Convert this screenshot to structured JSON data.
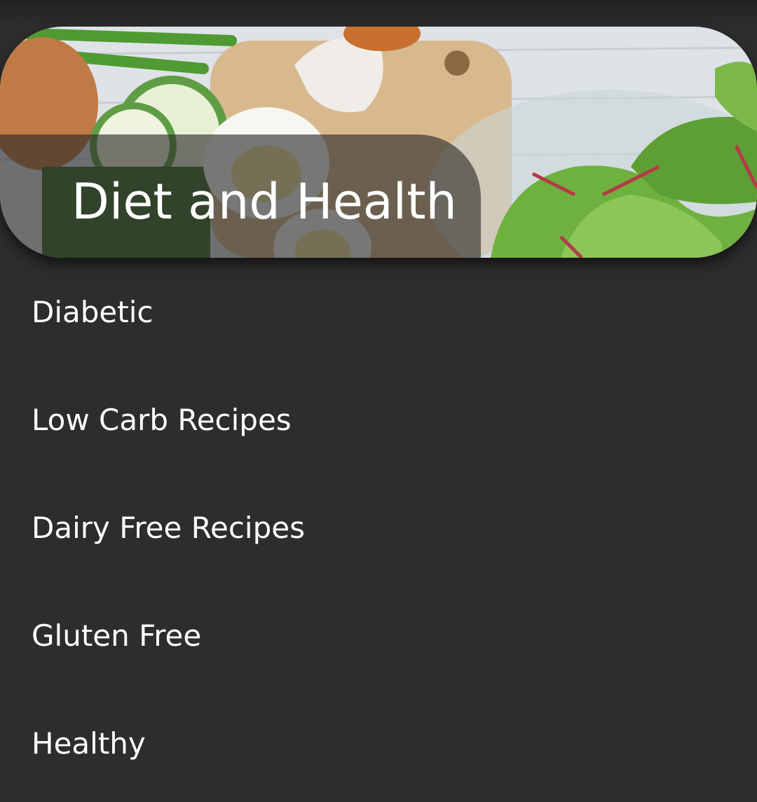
{
  "header": {
    "title": "Diet and Health",
    "image_icon": "salad-eggs-photo"
  },
  "menu": {
    "items": [
      {
        "label": "Diabetic"
      },
      {
        "label": "Low Carb Recipes"
      },
      {
        "label": "Dairy Free Recipes"
      },
      {
        "label": "Gluten Free"
      },
      {
        "label": "Healthy"
      }
    ]
  },
  "colors": {
    "background": "#2d2d2d",
    "text": "#ffffff",
    "plate": "#282828"
  }
}
